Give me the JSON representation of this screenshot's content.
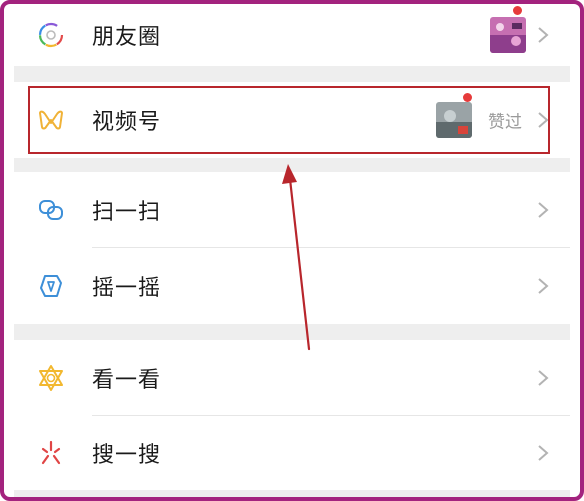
{
  "menu": {
    "moments": {
      "label": "朋友圈",
      "icon": "moments-icon"
    },
    "channels": {
      "label": "视频号",
      "icon": "channels-icon",
      "status": "赞过"
    },
    "scan": {
      "label": "扫一扫",
      "icon": "scan-icon"
    },
    "shake": {
      "label": "摇一摇",
      "icon": "shake-icon"
    },
    "top_stories": {
      "label": "看一看",
      "icon": "top-stories-icon"
    },
    "search": {
      "label": "搜一搜",
      "icon": "search-icon"
    }
  },
  "colors": {
    "frame_border": "#a3237e",
    "highlight_border": "#b8262c",
    "arrow": "#b8262c",
    "notification_dot": "#e63b3b",
    "section_gap": "#eeeeee"
  }
}
